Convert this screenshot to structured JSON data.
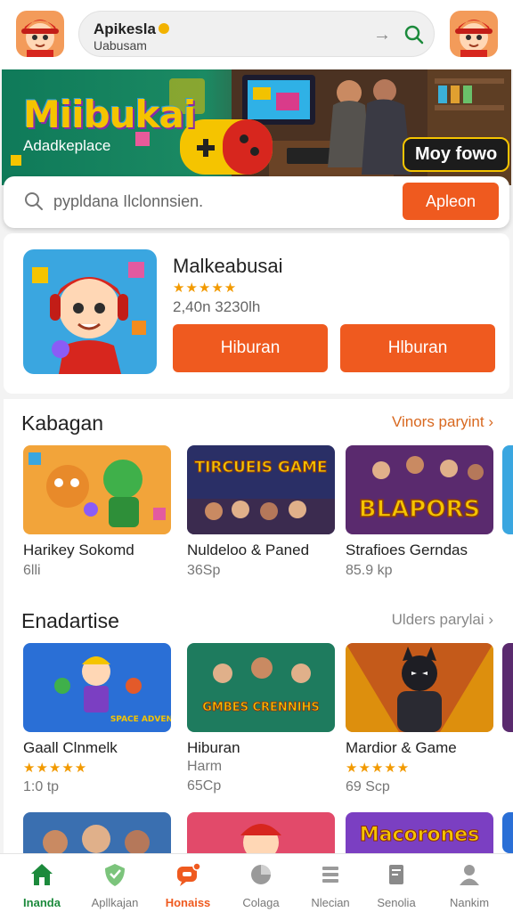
{
  "header": {
    "search_title": "Apikesla",
    "search_subtitle": "Uabusam"
  },
  "banner": {
    "title": "Miibukai",
    "subtitle": "Adadkeplace",
    "cta": "Moy fowo"
  },
  "search": {
    "placeholder": "pypldana Ilclonnsien.",
    "button_label": "Apleon"
  },
  "featured": {
    "title": "Malkeabusai",
    "stars": "★★★★★",
    "meta": "2,40n 3230lh",
    "button_1": "Hiburan",
    "button_2": "Hlburan"
  },
  "sections": [
    {
      "title": "Kabagan",
      "link": "Vinors paryint",
      "cards": [
        {
          "name": "Harikey Sokomd",
          "sub": "6lli"
        },
        {
          "name": "Nuldeloo & Paned",
          "sub": "36Sp",
          "art_text": "TIRCUEIS GAME"
        },
        {
          "name": "Strafioes Gerndas",
          "sub": "85.9 kp",
          "art_text": "BLAPORS"
        }
      ]
    },
    {
      "title": "Enadartise",
      "link": "Ulders parylai",
      "cards": [
        {
          "name": "Gaall Clnmelk",
          "sub": "1:0 tp",
          "stars": "★★★★★",
          "art_text": "SPACE ADVENT"
        },
        {
          "name": "Hiburan",
          "sub": "65Cp",
          "tag": "Harm",
          "art_text": "GMBES CRENNIHS"
        },
        {
          "name": "Mardior & Game",
          "sub": "69 Scp",
          "stars": "★★★★★"
        }
      ]
    },
    {
      "cards": [
        {
          "name": ""
        },
        {
          "name": ""
        },
        {
          "name": "",
          "art_text": "Macorones"
        }
      ]
    }
  ],
  "bottom_nav": [
    {
      "label": "Inanda",
      "icon": "home-icon",
      "state": "active"
    },
    {
      "label": "Apllkajan",
      "icon": "shield-icon"
    },
    {
      "label": "Honaiss",
      "icon": "chat-notification-icon",
      "state": "hot"
    },
    {
      "label": "Colaga",
      "icon": "pie-chart-icon"
    },
    {
      "label": "Nlecian",
      "icon": "list-icon"
    },
    {
      "label": "Senolia",
      "icon": "document-icon"
    },
    {
      "label": "Nankim",
      "icon": "profile-icon"
    }
  ],
  "colors": {
    "accent": "#ef5a1f",
    "nav_active": "#1c8a3c",
    "star": "#f29a00"
  }
}
